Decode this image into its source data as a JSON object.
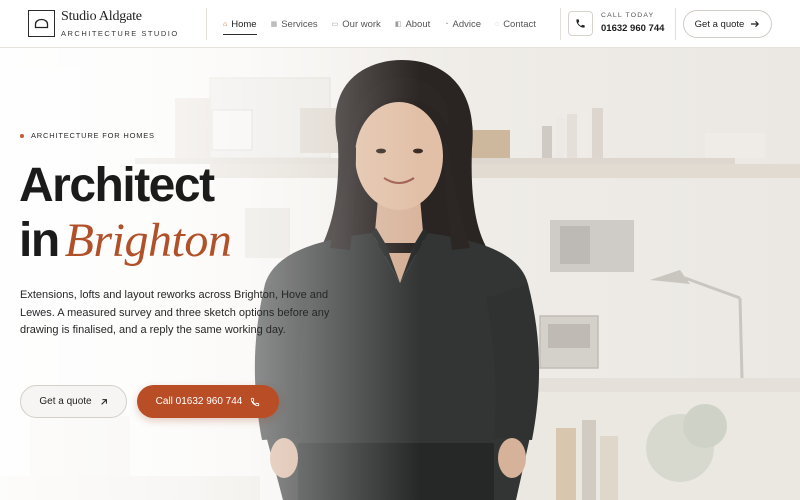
{
  "header": {
    "brand_name": "Studio Aldgate",
    "brand_tagline": "ARCHITECTURE STUDIO",
    "nav": [
      {
        "label": "Home",
        "icon": "home-icon",
        "active": true
      },
      {
        "label": "Services",
        "icon": "services-icon",
        "active": false
      },
      {
        "label": "Our work",
        "icon": "portfolio-icon",
        "active": false
      },
      {
        "label": "About",
        "icon": "about-icon",
        "active": false
      },
      {
        "label": "Advice",
        "icon": "advice-icon",
        "active": false
      },
      {
        "label": "Contact",
        "icon": "contact-icon",
        "active": false
      }
    ],
    "call_label": "CALL TODAY",
    "call_number": "01632 960 744",
    "quote_label": "Get a quote"
  },
  "hero": {
    "eyebrow": "ARCHITECTURE FOR HOMES",
    "title_line1": "Architect",
    "title_in": "in",
    "title_accent": "Brighton",
    "description": "Extensions, lofts and layout reworks across Brighton, Hove and Lewes. A measured survey and three sketch options before any drawing is finalised, and a reply the same working day.",
    "quote_button": "Get a quote",
    "call_button": "Call 01632 960 744"
  },
  "colors": {
    "accent": "#b84d26",
    "text": "#1b1b1b",
    "header_bg": "#ffffff"
  }
}
